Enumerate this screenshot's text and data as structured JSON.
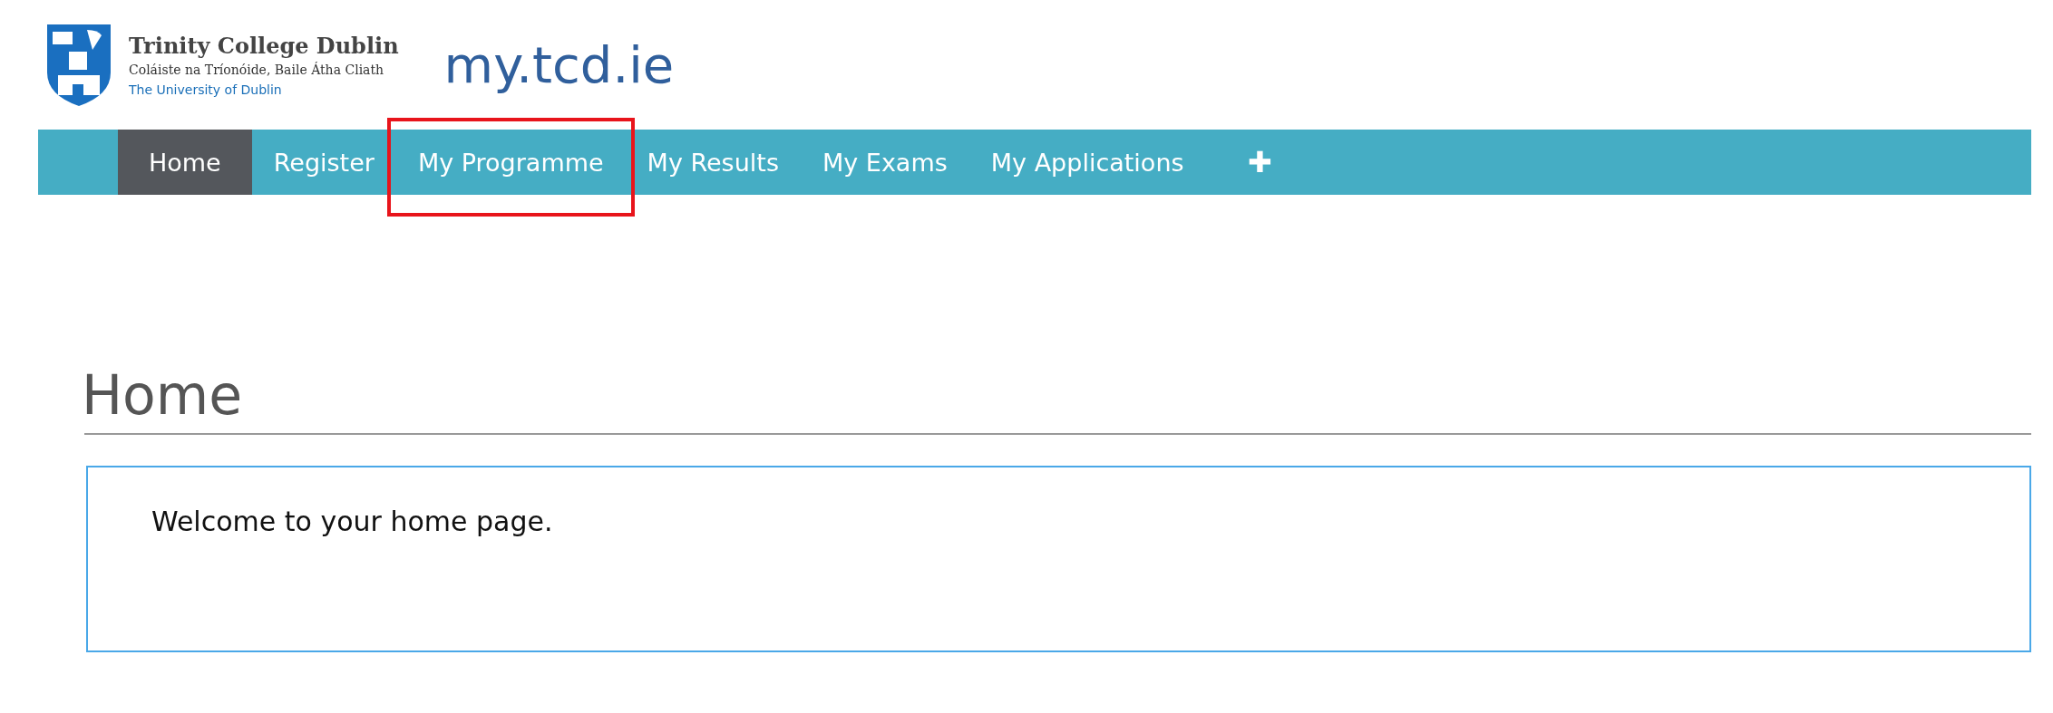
{
  "logo": {
    "name": "Trinity College Dublin",
    "irish_name": "Coláiste na Tríonóide, Baile Átha Cliath",
    "subtitle": "The University of Dublin"
  },
  "site_title": "my.tcd.ie",
  "nav": [
    {
      "label": "Home",
      "selected": true,
      "highlighted": false
    },
    {
      "label": "Register",
      "selected": false,
      "highlighted": false
    },
    {
      "label": "My Programme",
      "selected": false,
      "highlighted": true
    },
    {
      "label": "My Results",
      "selected": false,
      "highlighted": false
    },
    {
      "label": "My Exams",
      "selected": false,
      "highlighted": false
    },
    {
      "label": "My Applications",
      "selected": false,
      "highlighted": false
    }
  ],
  "nav_more": "✚",
  "heading": "Home",
  "welcome": "Welcome to your home page."
}
